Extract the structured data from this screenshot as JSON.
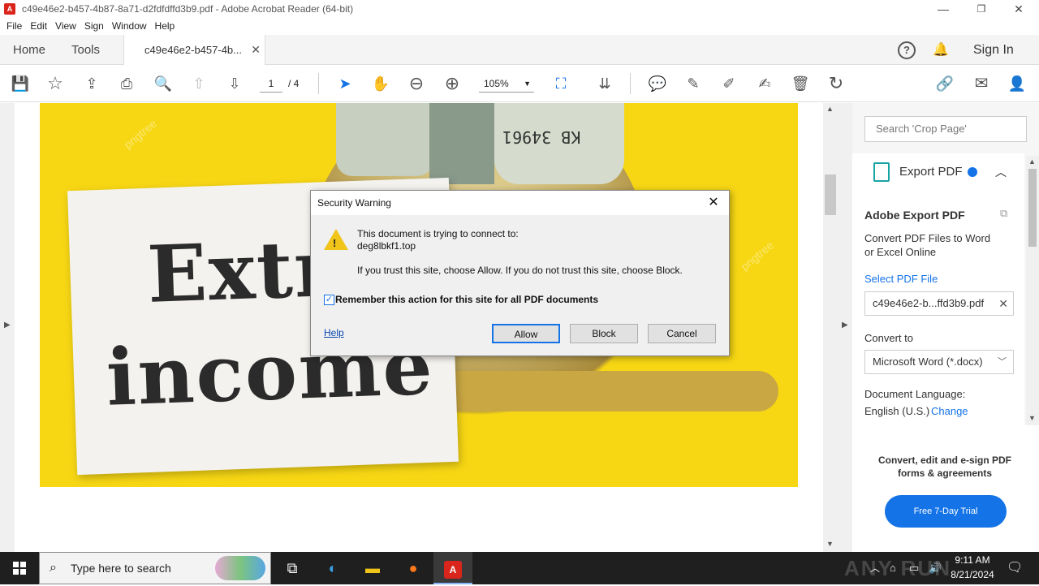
{
  "window": {
    "title": "c49e46e2-b457-4b87-8a71-d2fdfdffd3b9.pdf - Adobe Acrobat Reader (64-bit)",
    "app_icon_glyph": "A",
    "min_glyph": "—",
    "max_glyph": "❐",
    "close_glyph": "✕"
  },
  "menu": [
    "File",
    "Edit",
    "View",
    "Sign",
    "Window",
    "Help"
  ],
  "tabs": {
    "home": "Home",
    "tools": "Tools",
    "doc": "c49e46e2-b457-4b...",
    "close_glyph": "✕",
    "sign_in": "Sign In",
    "help_glyph": "?",
    "bell_glyph": "🔔"
  },
  "toolbar": {
    "page_current": "1",
    "page_total": "/ 4",
    "zoom": "105%",
    "icons": {
      "save": "💾",
      "star": "☆",
      "upload": "⇪",
      "print": "⎙",
      "zoom_search": "🔍",
      "prev_page": "⇧",
      "next_page": "⇩",
      "select": "➤",
      "hand": "✋",
      "zoom_out": "⊖",
      "zoom_in": "⊕",
      "fit": "⛶",
      "scroll": "⇊",
      "comment": "💬",
      "highlight": "✎",
      "draw": "✐",
      "fill_sign": "✍",
      "delete": "🗑",
      "rotate": "↻",
      "link": "🔗",
      "email": "✉",
      "share": "👤"
    }
  },
  "page_content": {
    "word1": "Extr",
    "word2": "income",
    "watermark": "pngtree",
    "bill_text": "KB 34961"
  },
  "right_panel": {
    "search_placeholder": "Search 'Crop Page'",
    "export_title": "Export PDF",
    "card_title": "Adobe Export PDF",
    "card_desc_1": "Convert PDF Files to Word",
    "card_desc_2": "or Excel Online",
    "select_file": "Select PDF File",
    "file_name": "c49e46e2-b...ffd3b9.pdf",
    "convert_to": "Convert to",
    "format": "Microsoft Word (*.docx)",
    "doc_language": "Document Language:",
    "language": "English (U.S.)",
    "change": "Change",
    "promo_1": "Convert, edit and e-sign PDF",
    "promo_2": "forms & agreements",
    "trial": "Free 7-Day Trial",
    "accent": "#1473e6"
  },
  "dialog": {
    "title": "Security Warning",
    "line1": "This document is trying to connect to:",
    "host": "deg8lbkf1.top",
    "line2": "If you trust this site, choose Allow. If you do not trust this site, choose Block.",
    "remember": "Remember this action for this site for all PDF documents",
    "remember_checked": true,
    "help": "Help",
    "allow": "Allow",
    "block": "Block",
    "cancel": "Cancel",
    "close_glyph": "✕",
    "warning_glyph": "!"
  },
  "taskbar": {
    "search_placeholder": "Type here to search",
    "time": "9:11 AM",
    "date": "8/21/2024",
    "watermark": "ANY RUN"
  }
}
